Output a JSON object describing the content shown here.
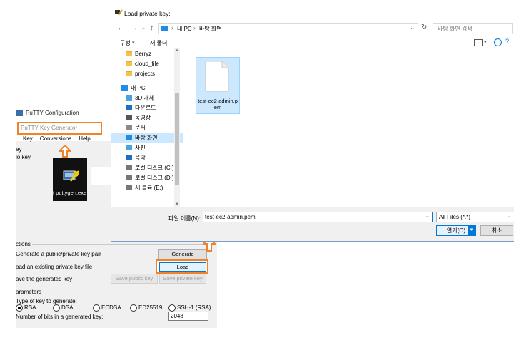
{
  "putty": {
    "title": "PuTTY Configuration",
    "keygen_title": "PuTTY Key Generator",
    "menu": [
      "Key",
      "Conversions",
      "Help"
    ],
    "key_group": "ey",
    "no_key": "lo key.",
    "exe_label": "t puttygen.exe",
    "actions_group": "ctions",
    "action_generate_label": "Generate a public/private key pair",
    "action_load_label": "oad an existing private key file",
    "action_save_label": "ave the generated key",
    "generate_button": "Generate",
    "load_button": "Load",
    "save_public_button": "Save public key",
    "save_private_button": "Save private key",
    "parameters_group": "arameters",
    "key_type_label": "Type of key to generate:",
    "key_types": [
      "RSA",
      "DSA",
      "ECDSA",
      "ED25519",
      "SSH-1 (RSA)"
    ],
    "selected_key_type": "RSA",
    "bits_label": "Number of bits in a generated key:",
    "bits_value": "2048"
  },
  "dialog": {
    "title": "Load private key:",
    "address_path": [
      "내 PC",
      "바탕 화면"
    ],
    "search_placeholder": "바탕 화면 검색",
    "organize_label": "구성",
    "new_folder_label": "새 폴더",
    "nav_items": [
      {
        "label": "Berryz",
        "icon": "folder-icon"
      },
      {
        "label": "cloud_file",
        "icon": "folder-icon"
      },
      {
        "label": "projects",
        "icon": "folder-icon"
      },
      {
        "label": "내 PC",
        "icon": "pc-icon"
      },
      {
        "label": "3D 개체",
        "icon": "cube-icon"
      },
      {
        "label": "다운로드",
        "icon": "download-icon"
      },
      {
        "label": "동영상",
        "icon": "video-icon"
      },
      {
        "label": "문서",
        "icon": "document-icon"
      },
      {
        "label": "바탕 화면",
        "icon": "desktop-icon"
      },
      {
        "label": "사진",
        "icon": "picture-icon"
      },
      {
        "label": "음악",
        "icon": "music-icon"
      },
      {
        "label": "로컬 디스크 (C:)",
        "icon": "drive-icon"
      },
      {
        "label": "로컬 디스크 (D:)",
        "icon": "drive-icon"
      },
      {
        "label": "새 볼륨 (E:)",
        "icon": "drive-icon"
      }
    ],
    "selected_nav": "바탕 화면",
    "file_name": "test-ec2-admin.pem",
    "file_label_line1": "test-ec2-admin.p",
    "file_label_line2": "em",
    "filename_label": "파일 이름(N):",
    "filename_value": "test-ec2-admin.pem",
    "filter_value": "All Files (*.*)",
    "open_button": "열기(O)",
    "cancel_button": "취소"
  },
  "colors": {
    "highlight": "#f0822a",
    "selection": "#cce8ff",
    "accent": "#0078d7"
  }
}
